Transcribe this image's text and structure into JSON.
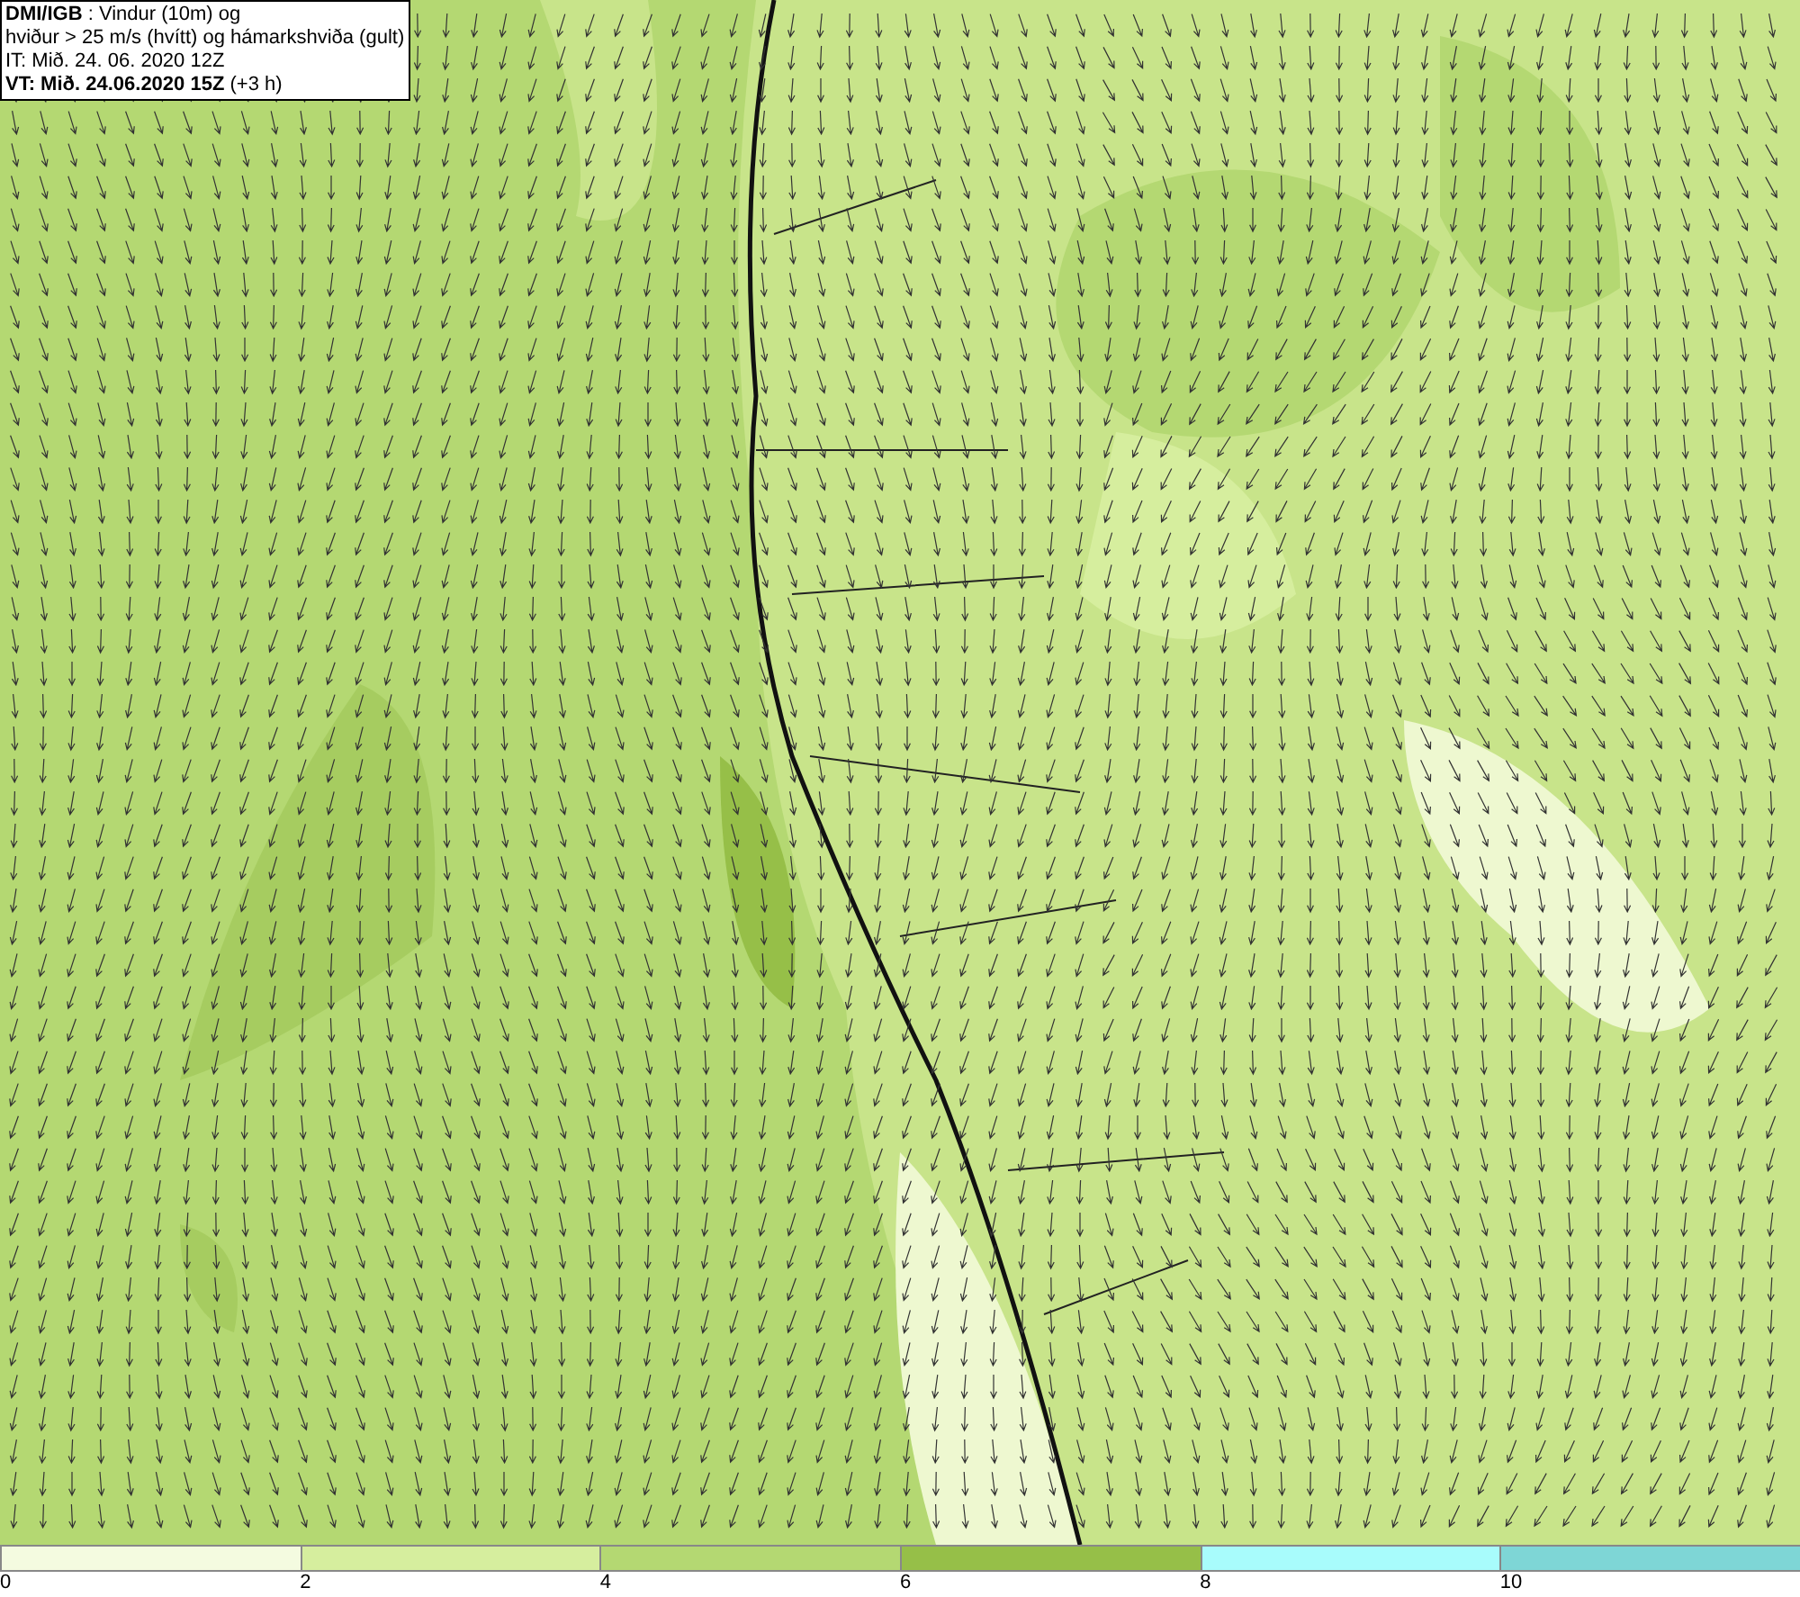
{
  "info_box": {
    "lines": [
      "**DMI/IGB** : Vindur (10m) og",
      "hviður > 25 m/s (hvítt) og hámarkshviða (gult)",
      "IT: Mið. 24. 06. 2020 12Z",
      "**VT: Mið. 24.06.2020 15Z** (+3 h)"
    ]
  },
  "legend": {
    "segments": [
      {
        "color": "#f4fbe0"
      },
      {
        "color": "#d6ee9e"
      },
      {
        "color": "#b4d872"
      },
      {
        "color": "#96bf48"
      },
      {
        "color": "#a8fcfc"
      },
      {
        "color": "#7ed6d6"
      }
    ],
    "ticks": [
      "0",
      "2",
      "4",
      "6",
      "8",
      "10"
    ]
  }
}
